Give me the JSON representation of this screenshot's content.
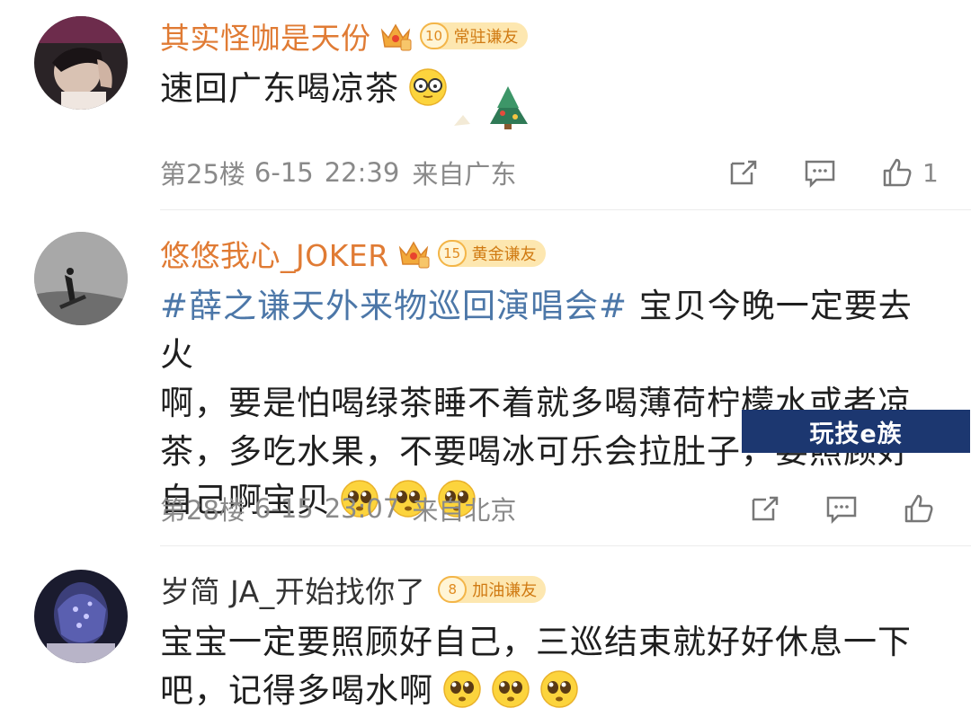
{
  "comments": [
    {
      "username": "其实怪咖是天份",
      "badge_level": "10",
      "badge_label": "常驻谦友",
      "text": "速回广东喝凉茶",
      "floor": "第25楼",
      "date": "6-15",
      "time": "22:39",
      "location": "来自广东",
      "like_count": "1"
    },
    {
      "username": "悠悠我心_JOKER",
      "badge_level": "15",
      "badge_label": "黄金谦友",
      "hashtag": "#薛之谦天外来物巡回演唱会#",
      "text_line1_rest": " 宝贝今晚一定要去火",
      "text_line2": "啊，要是怕喝绿茶睡不着就多喝薄荷柠檬水或者凉",
      "text_line3": "茶，多吃水果，不要喝冰可乐会拉肚子，要照顾好",
      "text_line4": "自己啊宝贝",
      "floor": "第28楼",
      "date": "6-15",
      "time": "23:07",
      "location": "来自北京"
    },
    {
      "username": "岁简 JA_开始找你了",
      "badge_level": "8",
      "badge_label": "加油谦友",
      "text_line1": "宝宝一定要照顾好自己，三巡结束就好好休息一下",
      "text_line2": "吧，记得多喝水啊"
    }
  ],
  "watermark": "玩技e族",
  "icons": {
    "share": "share-icon",
    "comment": "comment-icon",
    "like": "like-icon",
    "crown": "crown-icon"
  },
  "colors": {
    "username_vip": "#e07b34",
    "hashtag": "#4c77a8",
    "meta": "#8a8a8a",
    "watermark_bg": "#1c3770"
  }
}
